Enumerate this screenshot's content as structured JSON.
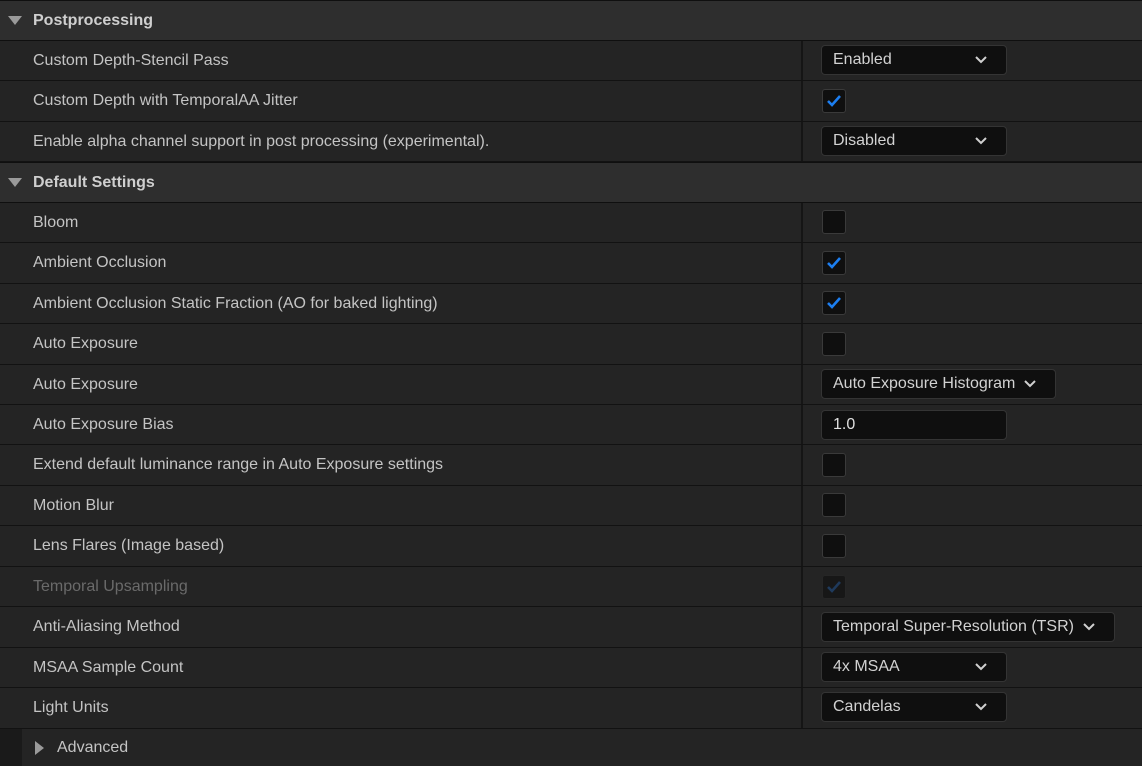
{
  "categories": {
    "postprocessing": "Postprocessing",
    "default_settings": "Default Settings"
  },
  "postprocessing": {
    "custom_depth_stencil": {
      "label": "Custom Depth-Stencil Pass",
      "value": "Enabled"
    },
    "custom_depth_jitter": {
      "label": "Custom Depth with TemporalAA Jitter",
      "checked": true
    },
    "alpha_channel": {
      "label": "Enable alpha channel support in post processing (experimental).",
      "value": "Disabled"
    }
  },
  "default_settings": {
    "bloom": {
      "label": "Bloom",
      "checked": false
    },
    "ambient_occlusion": {
      "label": "Ambient Occlusion",
      "checked": true
    },
    "ao_static_fraction": {
      "label": "Ambient Occlusion Static Fraction (AO for baked lighting)",
      "checked": true
    },
    "auto_exposure_toggle": {
      "label": "Auto Exposure",
      "checked": false
    },
    "auto_exposure_method": {
      "label": "Auto Exposure",
      "value": "Auto Exposure Histogram"
    },
    "auto_exposure_bias": {
      "label": "Auto Exposure Bias",
      "value": "1.0"
    },
    "extend_luminance": {
      "label": "Extend default luminance range in Auto Exposure settings",
      "checked": false
    },
    "motion_blur": {
      "label": "Motion Blur",
      "checked": false
    },
    "lens_flares": {
      "label": "Lens Flares (Image based)",
      "checked": false
    },
    "temporal_upsampling": {
      "label": "Temporal Upsampling",
      "checked": true,
      "disabled": true
    },
    "anti_aliasing": {
      "label": "Anti-Aliasing Method",
      "value": "Temporal Super-Resolution (TSR)"
    },
    "msaa": {
      "label": "MSAA Sample Count",
      "value": "4x MSAA"
    },
    "light_units": {
      "label": "Light Units",
      "value": "Candelas"
    }
  },
  "advanced": {
    "label": "Advanced"
  },
  "colors": {
    "panel_bg": "#242424",
    "category_bg": "#2e2e2e",
    "check_accent": "#1c7ef0"
  },
  "icons": {
    "expanded": "triangle-down-icon",
    "collapsed": "triangle-right-icon",
    "dropdown": "chevron-down-icon",
    "check": "checkmark-icon"
  }
}
